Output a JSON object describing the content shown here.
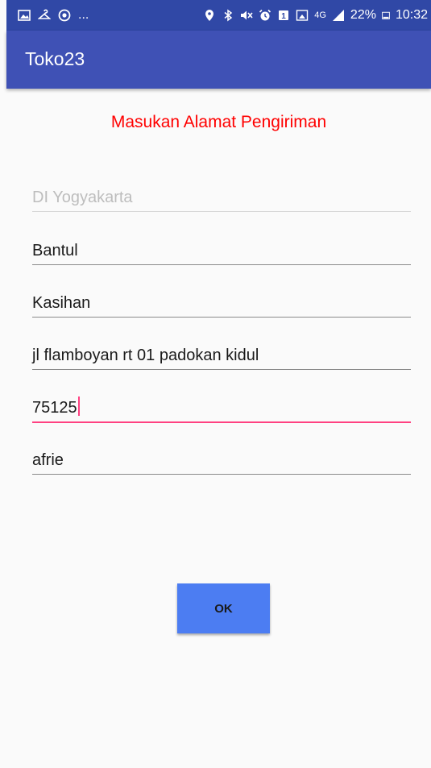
{
  "status_bar": {
    "left_icons": [
      "gallery-icon",
      "hanger-icon",
      "chrome-icon"
    ],
    "overflow": "...",
    "right_icons": [
      "location-icon",
      "bluetooth-icon",
      "mute-icon",
      "alarm-icon",
      "sim-icon",
      "screenshot-icon"
    ],
    "network_type": "4G",
    "battery": "22%",
    "time": "10:32"
  },
  "app": {
    "title": "Toko23",
    "primary_color": "#3f51b5",
    "accent_color": "#ff4081"
  },
  "form": {
    "heading": "Masukan Alamat Pengiriman",
    "province_placeholder": "DI Yogyakarta",
    "city": "Bantul",
    "district": "Kasihan",
    "address": "jl flamboyan rt 01 padokan kidul",
    "postal_code": "75125",
    "name": "afrie",
    "ok_label": "OK"
  }
}
